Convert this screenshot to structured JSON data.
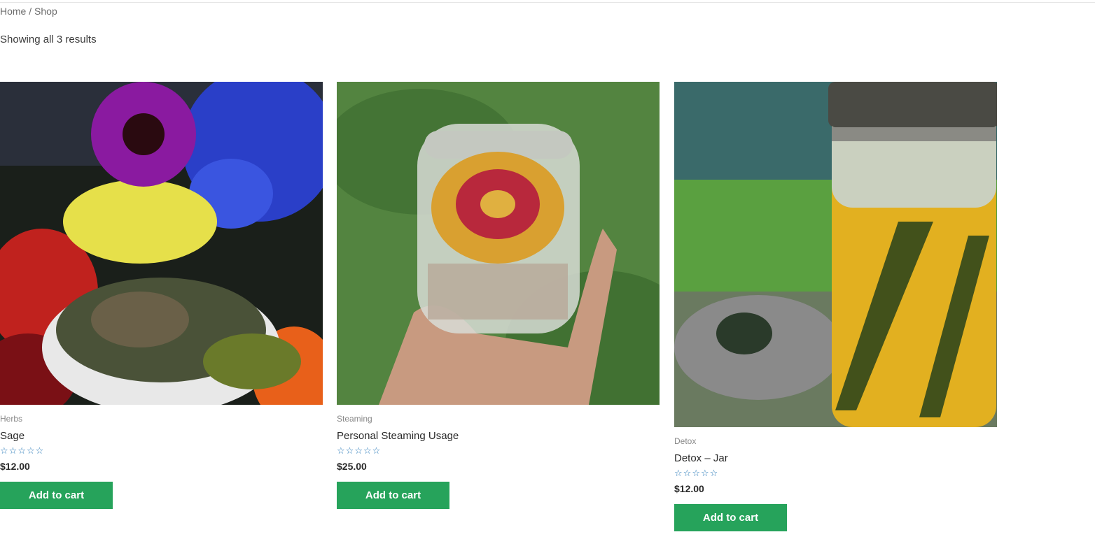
{
  "breadcrumb": {
    "home": "Home",
    "separator": " / ",
    "current": "Shop"
  },
  "result_count": "Showing all 3 results",
  "products": [
    {
      "category": "Herbs",
      "title": "Sage",
      "price": "$12.00",
      "rating": 0,
      "button": "Add to cart"
    },
    {
      "category": "Steaming",
      "title": "Personal Steaming Usage",
      "price": "$25.00",
      "rating": 0,
      "button": "Add to cart"
    },
    {
      "category": "Detox",
      "title": "Detox – Jar",
      "price": "$12.00",
      "rating": 0,
      "button": "Add to cart"
    }
  ],
  "colors": {
    "button": "#26a35b",
    "stars": "#2b7bb9"
  }
}
